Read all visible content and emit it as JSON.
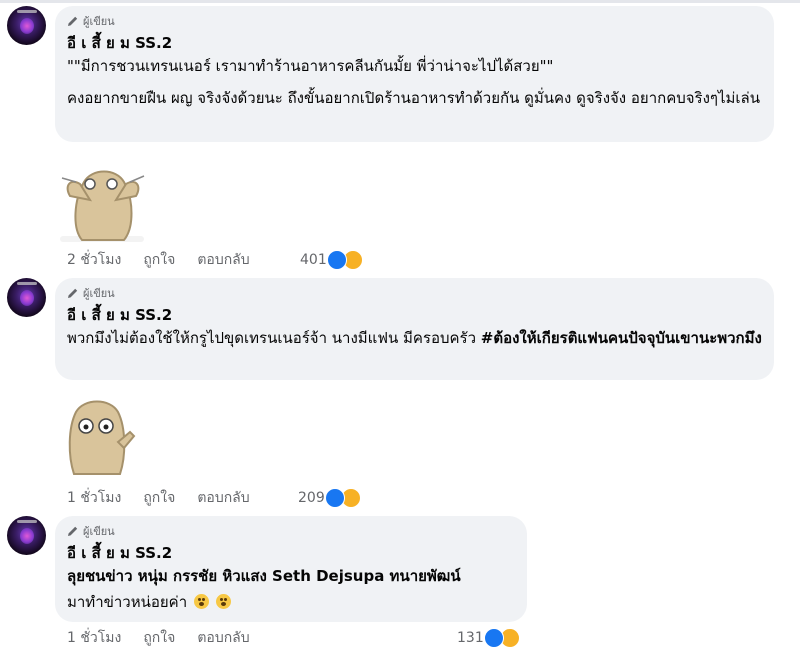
{
  "comments": [
    {
      "badge": "ผู้เขียน",
      "author": "อี เ สี้ ย ม SS.2",
      "line1": "\"\"มีการชวนเทรนเนอร์ เรามาทำร้านอาหารคลีนกันมั้ย พี่ว่าน่าจะไปได้สวย\"\"",
      "line2": "คงอยากขายฝืน ผญ จริงจังด้วยนะ ถึงขั้นอยากเปิดร้านอาหารทำด้วยกัน ดูมั่นคง ดูจริงจัง อยากคบจริงๆไม่เล่น",
      "time": "2 ชั่วโมง",
      "like": "ถูกใจ",
      "reply": "ตอบกลับ",
      "reactions": "401"
    },
    {
      "badge": "ผู้เขียน",
      "author": "อี เ สี้ ย ม SS.2",
      "line1": "พวกมึงไม่ต้องใช้ให้กรูไปขุดเทรนเนอร์จ้า นางมีแฟน มีครอบครัว",
      "line1_bold": "#ต้องให้เกียรติแฟนคนปัจจุบันเขานะพวกมึง",
      "time": "1 ชั่วโมง",
      "like": "ถูกใจ",
      "reply": "ตอบกลับ",
      "reactions": "209"
    },
    {
      "badge": "ผู้เขียน",
      "author": "อี เ สี้ ย ม SS.2",
      "line1": "ลุยชนข่าว หนุ่ม กรรชัย หิวแสง Seth Dejsupa ทนายพัฒน์",
      "line2": "มาทำข่าวหน่อยค่า",
      "time": "1 ชั่วโมง",
      "like": "ถูกใจ",
      "reply": "ตอบกลับ",
      "reactions": "131"
    }
  ],
  "colors": {
    "bubble": "#f0f2f5",
    "meta": "#65676b",
    "like": "#1877f2",
    "haha": "#f7b125"
  },
  "icons": [
    "pencil-icon",
    "like-reaction-icon",
    "haha-reaction-icon",
    "smile-emoji-icon"
  ]
}
